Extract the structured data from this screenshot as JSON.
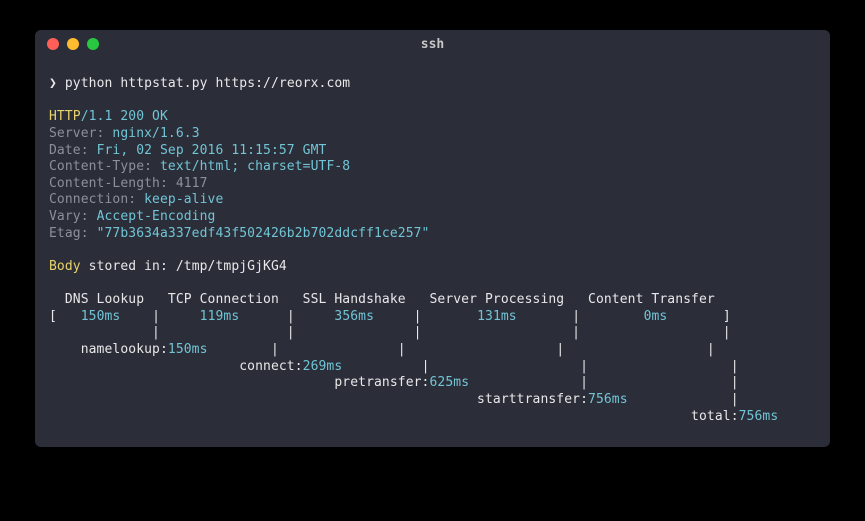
{
  "window": {
    "title": "ssh"
  },
  "prompt": {
    "symbol": "❯",
    "command": "python httpstat.py https://reorx.com"
  },
  "response": {
    "status_http": "HTTP",
    "status_rest": "/1.1 200 OK",
    "headers": {
      "server_label": "Server: ",
      "server_value": "nginx/1.6.3",
      "date_label": "Date: ",
      "date_value": "Fri, 02 Sep 2016 11:15:57 GMT",
      "ctype_label": "Content-Type: ",
      "ctype_value": "text/html; charset=UTF-8",
      "clen": "Content-Length: 4117",
      "conn_label": "Connection: ",
      "conn_value": "keep-alive",
      "vary_label": "Vary: ",
      "vary_value": "Accept-Encoding",
      "etag_label": "Etag: ",
      "etag_value": "\"77b3634a337edf43f502426b2b702ddcff1ce257\""
    },
    "body_label": "Body",
    "body_rest": " stored in: /tmp/tmpjGjKG4"
  },
  "chart_data": {
    "type": "table",
    "columns": [
      "DNS Lookup",
      "TCP Connection",
      "SSL Handshake",
      "Server Processing",
      "Content Transfer"
    ],
    "values_ms": [
      150,
      119,
      356,
      131,
      0
    ],
    "cumulative": {
      "namelookup": 150,
      "connect": 269,
      "pretransfer": 625,
      "starttransfer": 756,
      "total": 756
    }
  },
  "diagram": {
    "header": "  DNS Lookup   TCP Connection   SSL Handshake   Server Processing   Content Transfer",
    "row_open": "[   ",
    "v1": "150ms",
    "sep1": "    |     ",
    "v2": "119ms",
    "sep2": "      |     ",
    "v3": "356ms",
    "sep3": "     |       ",
    "v4": "131ms",
    "sep4": "       |        ",
    "v5": "0ms",
    "row_close": "       ]",
    "l3": "             |                |               |                   |                  |",
    "l4a": "    namelookup:",
    "l4v": "150ms",
    "l4b": "        |               |                   |                  |",
    "l5a": "                        connect:",
    "l5v": "269ms",
    "l5b": "          |                   |                  |",
    "l6a": "                                    pretransfer:",
    "l6v": "625ms",
    "l6b": "              |                  |",
    "l7a": "                                                      starttransfer:",
    "l7v": "756ms",
    "l7b": "             |",
    "l8a": "                                                                                 total:",
    "l8v": "756ms"
  }
}
